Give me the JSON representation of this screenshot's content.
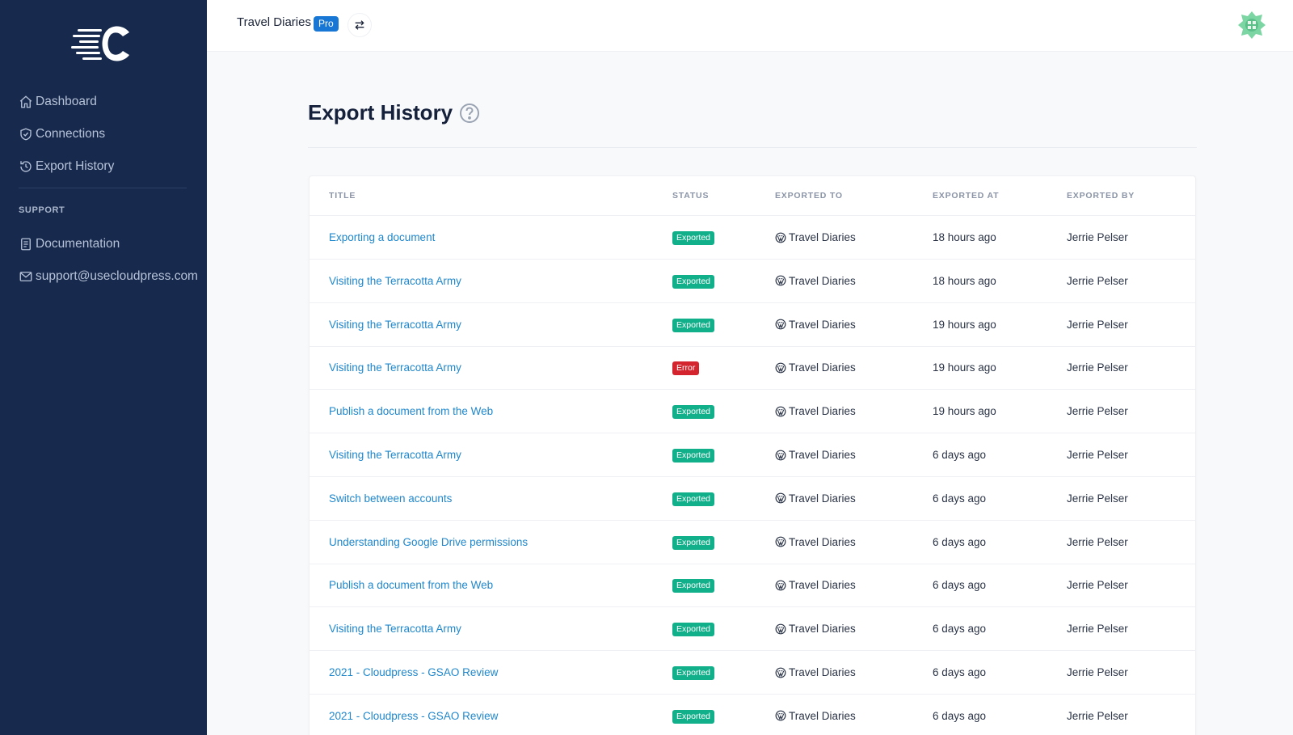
{
  "sidebar": {
    "nav": [
      {
        "label": "Dashboard",
        "icon": "home-icon"
      },
      {
        "label": "Connections",
        "icon": "shield-icon"
      },
      {
        "label": "Export History",
        "icon": "history-icon"
      }
    ],
    "support_label": "SUPPORT",
    "support": [
      {
        "label": "Documentation",
        "icon": "document-icon"
      },
      {
        "label": "support@usecloudpress.com",
        "icon": "mail-icon"
      }
    ]
  },
  "topbar": {
    "site_name": "Travel Diaries",
    "badge": "Pro"
  },
  "page": {
    "title": "Export History"
  },
  "table": {
    "headers": [
      "TITLE",
      "STATUS",
      "EXPORTED TO",
      "EXPORTED AT",
      "EXPORTED BY"
    ],
    "rows": [
      {
        "title": "Exporting a document",
        "status": "Exported",
        "to": "Travel Diaries",
        "at": "18 hours ago",
        "by": "Jerrie Pelser"
      },
      {
        "title": "Visiting the Terracotta Army",
        "status": "Exported",
        "to": "Travel Diaries",
        "at": "18 hours ago",
        "by": "Jerrie Pelser"
      },
      {
        "title": "Visiting the Terracotta Army",
        "status": "Exported",
        "to": "Travel Diaries",
        "at": "19 hours ago",
        "by": "Jerrie Pelser"
      },
      {
        "title": "Visiting the Terracotta Army",
        "status": "Error",
        "to": "Travel Diaries",
        "at": "19 hours ago",
        "by": "Jerrie Pelser"
      },
      {
        "title": "Publish a document from the Web",
        "status": "Exported",
        "to": "Travel Diaries",
        "at": "19 hours ago",
        "by": "Jerrie Pelser"
      },
      {
        "title": "Visiting the Terracotta Army",
        "status": "Exported",
        "to": "Travel Diaries",
        "at": "6 days ago",
        "by": "Jerrie Pelser"
      },
      {
        "title": "Switch between accounts",
        "status": "Exported",
        "to": "Travel Diaries",
        "at": "6 days ago",
        "by": "Jerrie Pelser"
      },
      {
        "title": "Understanding Google Drive permissions",
        "status": "Exported",
        "to": "Travel Diaries",
        "at": "6 days ago",
        "by": "Jerrie Pelser"
      },
      {
        "title": "Publish a document from the Web",
        "status": "Exported",
        "to": "Travel Diaries",
        "at": "6 days ago",
        "by": "Jerrie Pelser"
      },
      {
        "title": "Visiting the Terracotta Army",
        "status": "Exported",
        "to": "Travel Diaries",
        "at": "6 days ago",
        "by": "Jerrie Pelser"
      },
      {
        "title": "2021 - Cloudpress - GSAO Review",
        "status": "Exported",
        "to": "Travel Diaries",
        "at": "6 days ago",
        "by": "Jerrie Pelser"
      },
      {
        "title": "2021 - Cloudpress - GSAO Review",
        "status": "Exported",
        "to": "Travel Diaries",
        "at": "6 days ago",
        "by": "Jerrie Pelser"
      }
    ]
  },
  "colors": {
    "sidebar_bg": "#17294d",
    "accent": "#1877d4",
    "link": "#1f87cc",
    "exported": "#12b08a",
    "error": "#d4252f"
  },
  "icons": {
    "logo": "cloudpress-logo",
    "switch": "swap-arrows-icon",
    "help": "help-circle-icon",
    "avatar": "user-avatar",
    "wordpress": "wordpress-icon"
  }
}
